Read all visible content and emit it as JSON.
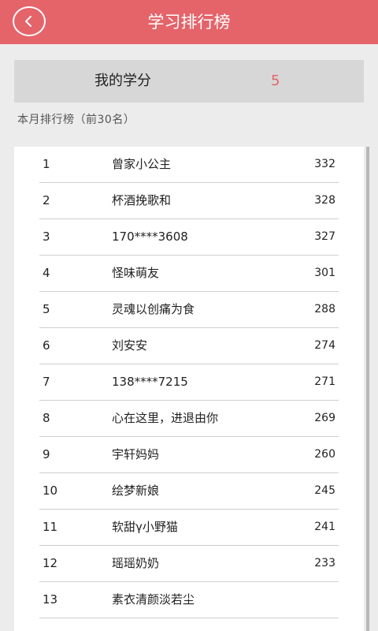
{
  "header": {
    "title": "学习排行榜",
    "back_icon": "back-arrow-icon"
  },
  "credits": {
    "label": "我的学分",
    "value": "5"
  },
  "ranking_title": "本月排行榜（前30名）",
  "rows": [
    {
      "rank": "1",
      "name": "曾家小公主",
      "score": "332"
    },
    {
      "rank": "2",
      "name": "杯酒挽歌和",
      "score": "328"
    },
    {
      "rank": "3",
      "name": "170****3608",
      "score": "327"
    },
    {
      "rank": "4",
      "name": "怪味萌友",
      "score": "301"
    },
    {
      "rank": "5",
      "name": "灵魂以创痛为食",
      "score": "288"
    },
    {
      "rank": "6",
      "name": "刘安安",
      "score": "274"
    },
    {
      "rank": "7",
      "name": "138****7215",
      "score": "271"
    },
    {
      "rank": "8",
      "name": "心在这里，进退由你",
      "score": "269"
    },
    {
      "rank": "9",
      "name": "宇轩妈妈",
      "score": "260"
    },
    {
      "rank": "10",
      "name": "绘梦新娘",
      "score": "245"
    },
    {
      "rank": "11",
      "name": "软甜γ小野猫",
      "score": "241"
    },
    {
      "rank": "12",
      "name": "瑶瑶奶奶",
      "score": "233"
    },
    {
      "rank": "13",
      "name": "素衣清颜淡若尘",
      "score": ""
    }
  ],
  "colors": {
    "header": "#e4646a",
    "accent": "#e4646a"
  }
}
